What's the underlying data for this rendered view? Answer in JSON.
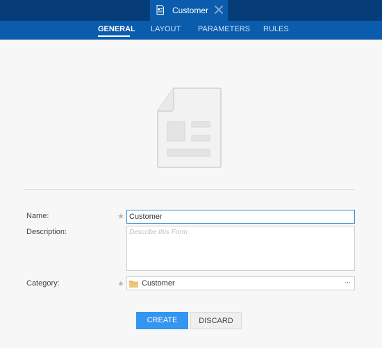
{
  "document_tab": {
    "title": "Customer",
    "icon": "form-document-icon",
    "close_icon": "close-icon"
  },
  "nav": {
    "tabs": [
      {
        "label": "GENERAL",
        "active": true
      },
      {
        "label": "LAYOUT",
        "active": false
      },
      {
        "label": "PARAMETERS",
        "active": false
      },
      {
        "label": "RULES",
        "active": false
      }
    ]
  },
  "illustration": {
    "icon": "form-placeholder-icon"
  },
  "form": {
    "name": {
      "label": "Name:",
      "value": "Customer",
      "required": true
    },
    "description": {
      "label": "Description:",
      "value": "",
      "placeholder": "Describe this Form"
    },
    "category": {
      "label": "Category:",
      "value": "Customer",
      "icon": "folder-icon",
      "more_icon": "more-dots-icon",
      "required": true
    }
  },
  "actions": {
    "create_label": "CREATE",
    "discard_label": "DISCARD"
  },
  "colors": {
    "header_dark": "#063d78",
    "header_blue": "#0b5cad",
    "primary_button": "#3396f0",
    "folder": "#e8b86a"
  }
}
